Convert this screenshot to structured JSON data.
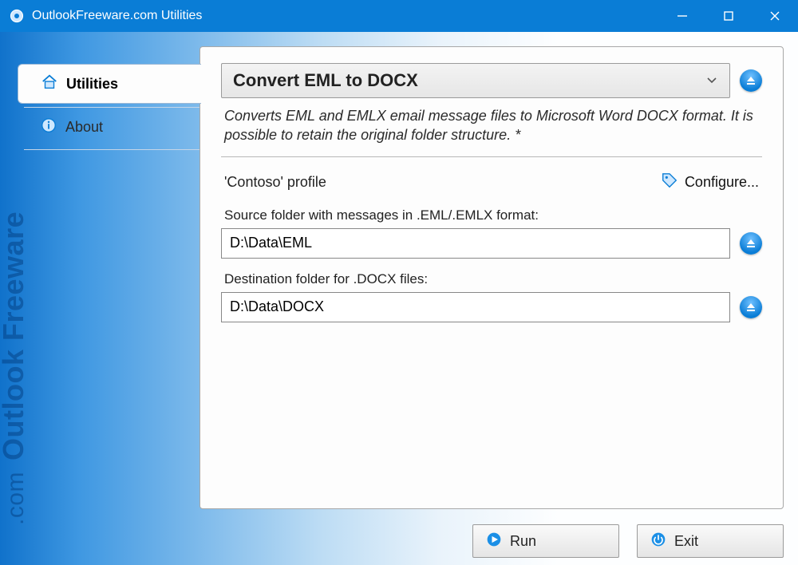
{
  "window": {
    "title": "OutlookFreeware.com Utilities"
  },
  "sidebar": {
    "items": [
      {
        "label": "Utilities"
      },
      {
        "label": "About"
      }
    ],
    "brand_main": "Outlook Freeware",
    "brand_domain": ".com"
  },
  "main": {
    "utility_name": "Convert EML to DOCX",
    "description": "Converts EML and EMLX email message files to Microsoft Word DOCX format. It is possible to retain the original folder structure. *",
    "profile_label": "'Contoso' profile",
    "configure_label": "Configure...",
    "source_label": "Source folder with messages in .EML/.EMLX format:",
    "source_path": "D:\\Data\\EML",
    "dest_label": "Destination folder for .DOCX files:",
    "dest_path": "D:\\Data\\DOCX"
  },
  "footer": {
    "run_label": "Run",
    "exit_label": "Exit"
  }
}
